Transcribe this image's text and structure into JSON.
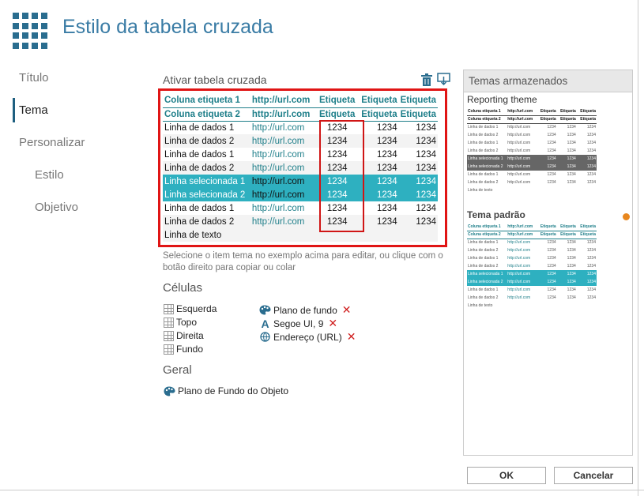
{
  "window": {
    "title": "Estilo da tabela cruzada"
  },
  "nav": {
    "items": [
      {
        "label": "Título"
      },
      {
        "label": "Tema"
      },
      {
        "label": "Personalizar"
      },
      {
        "label": "Estilo"
      },
      {
        "label": "Objetivo"
      }
    ],
    "active": "Tema"
  },
  "crosstab": {
    "label": "Ativar tabela cruzada",
    "rows": [
      {
        "c1": "Coluna etiqueta 1",
        "c2": "http://url.com",
        "c3": "Etiqueta",
        "c4": "Etiqueta",
        "c5": "Etiqueta"
      },
      {
        "c1": "Coluna etiqueta 2",
        "c2": "http://url.com",
        "c3": "Etiqueta",
        "c4": "Etiqueta",
        "c5": "Etiqueta"
      },
      {
        "c1": "Linha de dados 1",
        "c2": "http://url.com",
        "c3": "1234",
        "c4": "1234",
        "c5": "1234"
      },
      {
        "c1": "Linha de dados 2",
        "c2": "http://url.com",
        "c3": "1234",
        "c4": "1234",
        "c5": "1234"
      },
      {
        "c1": "Linha de dados 1",
        "c2": "http://url.com",
        "c3": "1234",
        "c4": "1234",
        "c5": "1234"
      },
      {
        "c1": "Linha de dados 2",
        "c2": "http://url.com",
        "c3": "1234",
        "c4": "1234",
        "c5": "1234"
      },
      {
        "c1": "Linha selecionada 1",
        "c2": "http://url.com",
        "c3": "1234",
        "c4": "1234",
        "c5": "1234"
      },
      {
        "c1": "Linha selecionada 2",
        "c2": "http://url.com",
        "c3": "1234",
        "c4": "1234",
        "c5": "1234"
      },
      {
        "c1": "Linha de dados 1",
        "c2": "http://url.com",
        "c3": "1234",
        "c4": "1234",
        "c5": "1234"
      },
      {
        "c1": "Linha de dados 2",
        "c2": "http://url.com",
        "c3": "1234",
        "c4": "1234",
        "c5": "1234"
      },
      {
        "c1": "Linha de texto",
        "c2": "",
        "c3": "",
        "c4": "",
        "c5": ""
      }
    ]
  },
  "help_text": "Selecione o item tema no exemplo acima para editar, ou clique com o botão direito para copiar ou colar",
  "cells": {
    "title": "Células",
    "positions": [
      "Esquerda",
      "Topo",
      "Direita",
      "Fundo"
    ],
    "properties": [
      {
        "label": "Plano de fundo",
        "icon": "palette-icon"
      },
      {
        "label": "Segoe UI, 9",
        "icon": "font-icon"
      },
      {
        "label": "Endereço (URL)",
        "icon": "link-icon"
      }
    ]
  },
  "general": {
    "title": "Geral",
    "item": "Plano de Fundo do Objeto"
  },
  "themes": {
    "title": "Temas armazenados",
    "theme1": {
      "name": "Reporting theme",
      "rows": [
        [
          "Coluna etiqueta 1",
          "http://url.com",
          "Etiqueta",
          "Etiqueta",
          "Etiqueta"
        ],
        [
          "Coluna etiqueta 2",
          "http://url.com",
          "Etiqueta",
          "Etiqueta",
          "Etiqueta"
        ],
        [
          "Linha de dados 1",
          "http://url.com",
          "1234",
          "1234",
          "1234"
        ],
        [
          "Linha de dados 2",
          "http://url.com",
          "1234",
          "1234",
          "1234"
        ],
        [
          "Linha de dados 1",
          "http://url.com",
          "1234",
          "1234",
          "1234"
        ],
        [
          "Linha de dados 2",
          "http://url.com",
          "1234",
          "1234",
          "1234"
        ],
        [
          "Linha selecionada 1",
          "http://url.com",
          "1234",
          "1234",
          "1234"
        ],
        [
          "Linha selecionada 2",
          "http://url.com",
          "1234",
          "1234",
          "1234"
        ],
        [
          "Linha de dados 1",
          "http://url.com",
          "1234",
          "1234",
          "1234"
        ],
        [
          "Linha de dados 2",
          "http://url.com",
          "1234",
          "1234",
          "1234"
        ],
        [
          "Linha de texto",
          "",
          "",
          "",
          ""
        ]
      ]
    },
    "theme2": {
      "name": "Tema padrão",
      "rows": [
        [
          "Coluna etiqueta 1",
          "http://url.com",
          "Etiqueta",
          "Etiqueta",
          "Etiqueta"
        ],
        [
          "Coluna etiqueta 2",
          "http://url.com",
          "Etiqueta",
          "Etiqueta",
          "Etiqueta"
        ],
        [
          "Linha de dados 1",
          "http://url.com",
          "1234",
          "1234",
          "1234"
        ],
        [
          "Linha de dados 2",
          "http://url.com",
          "1234",
          "1234",
          "1234"
        ],
        [
          "Linha de dados 1",
          "http://url.com",
          "1234",
          "1234",
          "1234"
        ],
        [
          "Linha de dados 2",
          "http://url.com",
          "1234",
          "1234",
          "1234"
        ],
        [
          "Linha selecionada 1",
          "http://url.com",
          "1234",
          "1234",
          "1234"
        ],
        [
          "Linha selecionada 2",
          "http://url.com",
          "1234",
          "1234",
          "1234"
        ],
        [
          "Linha de dados 1",
          "http://url.com",
          "1234",
          "1234",
          "1234"
        ],
        [
          "Linha de dados 2",
          "http://url.com",
          "1234",
          "1234",
          "1234"
        ],
        [
          "Linha de texto",
          "",
          "",
          "",
          ""
        ]
      ]
    }
  },
  "buttons": {
    "ok": "OK",
    "cancel": "Cancelar"
  },
  "colors": {
    "accent": "#2eb0c0",
    "teal_text": "#1f7f8a",
    "highlight_border": "#e01515",
    "title": "#3a7ca5"
  }
}
